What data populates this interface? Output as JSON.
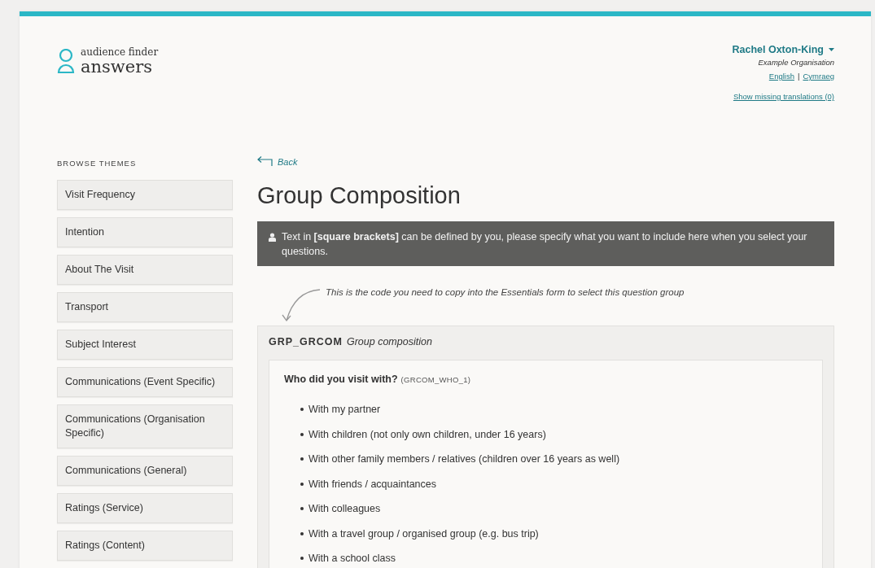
{
  "logo": {
    "small": "audience finder",
    "large": "answers"
  },
  "user": {
    "name": "Rachel Oxton-King",
    "organisation": "Example Organisation",
    "languages": [
      "English",
      "Cymraeg"
    ],
    "language_separator": "|",
    "missing_translations": "Show missing translations (0)"
  },
  "sidebar": {
    "title": "BROWSE THEMES",
    "items": [
      {
        "label": "Visit Frequency"
      },
      {
        "label": "Intention"
      },
      {
        "label": "About The Visit"
      },
      {
        "label": "Transport"
      },
      {
        "label": "Subject Interest"
      },
      {
        "label": "Communications (Event Specific)"
      },
      {
        "label": "Communications (Organisation Specific)"
      },
      {
        "label": "Communications (General)"
      },
      {
        "label": "Ratings (Service)"
      },
      {
        "label": "Ratings (Content)"
      }
    ]
  },
  "back": "Back",
  "title": "Group Composition",
  "notice": "Text in **[square brackets]** can be defined by you, please specify what you want to include here when you select your questions.",
  "hint": "This is the code you need to copy into the Essentials form to select this question group",
  "group": {
    "code": "GRP_GRCOM",
    "name": "Group composition",
    "question": {
      "text": "Who did you visit with?",
      "code": "(GRCOM_WHO_1)",
      "options": [
        "With my partner",
        "With children (not only own children, under 16 years)",
        "With other family members / relatives (children over 16 years as well)",
        "With friends / acquaintances",
        "With colleagues",
        "With a travel group / organised group (e.g. bus trip)",
        "With a school class"
      ]
    }
  }
}
